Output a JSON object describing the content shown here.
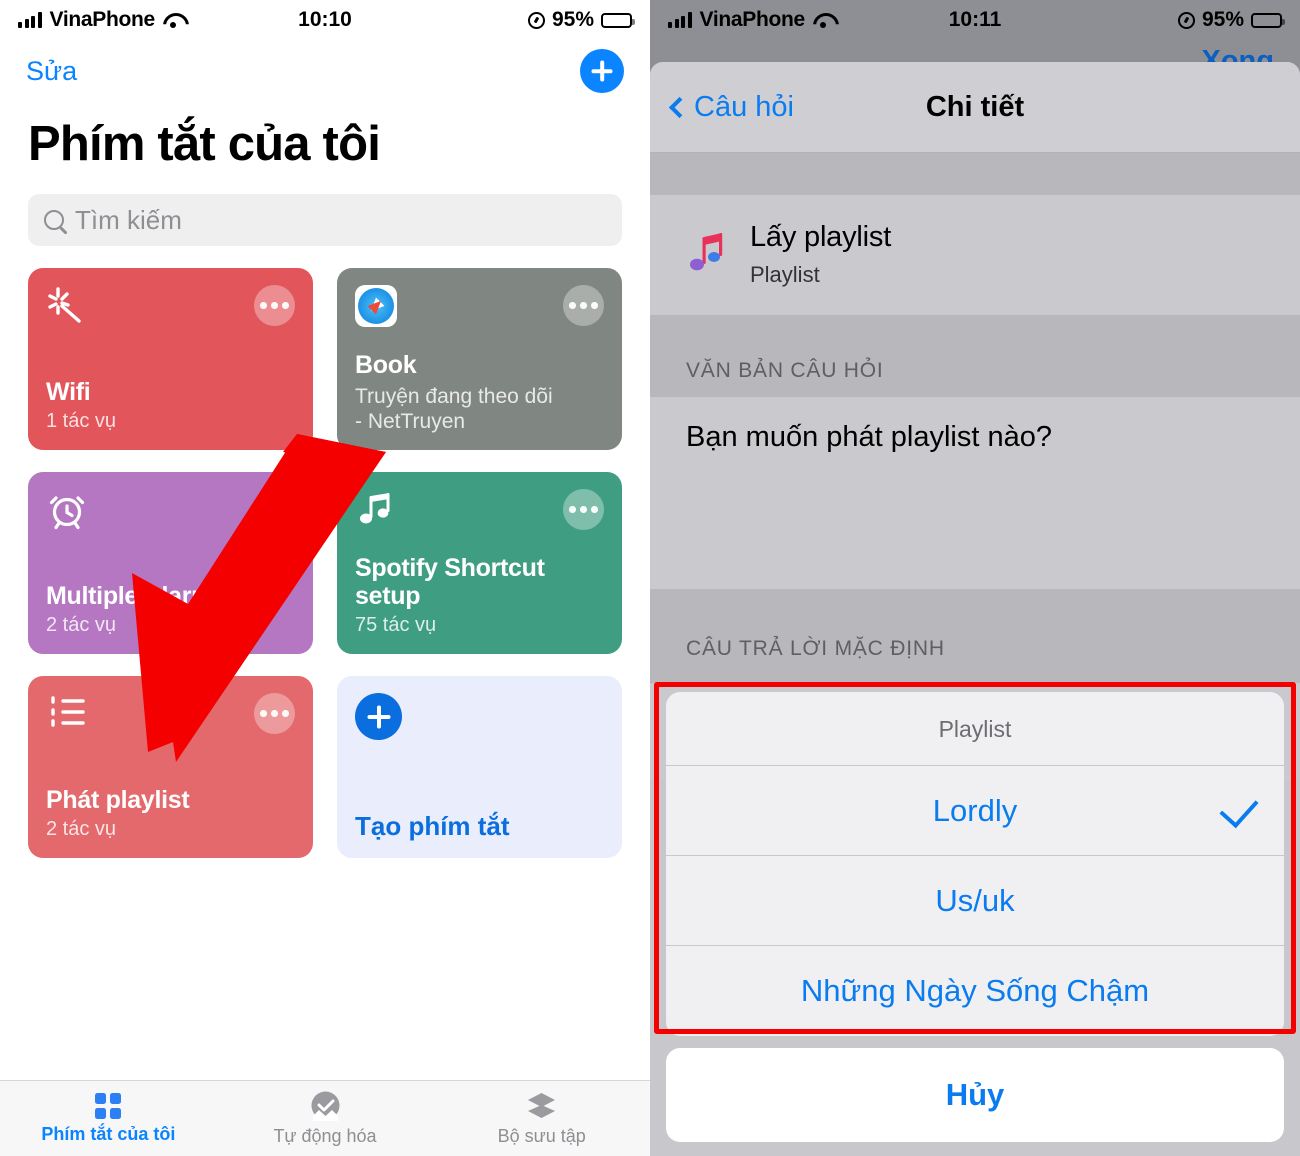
{
  "left": {
    "status": {
      "carrier": "VinaPhone",
      "time": "10:10",
      "battery": "95%",
      "icons": [
        "signal-icon",
        "wifi-icon",
        "lock-rotation-icon",
        "battery-icon"
      ]
    },
    "nav": {
      "edit_label": "Sửa",
      "add_label": "add-icon"
    },
    "title": "Phím tắt của tôi",
    "search": {
      "placeholder": "Tìm kiếm",
      "value": ""
    },
    "cards": [
      {
        "name": "Wifi",
        "sub": "1 tác vụ",
        "sub2": "",
        "icon": "magic-wand-icon",
        "color": "#e2555b"
      },
      {
        "name": "Book",
        "sub": "Truyện đang theo dõi",
        "sub2": "- NetTruyen",
        "icon": "safari-icon",
        "color": "#808782"
      },
      {
        "name": "Multiple Alarms",
        "sub": "2 tác vụ",
        "sub2": "",
        "icon": "alarm-clock-icon",
        "color": "#b577c2"
      },
      {
        "name": "Spotify Shortcut setup",
        "sub": "75 tác vụ",
        "sub2": "",
        "icon": "music-note-icon",
        "color": "#3f9e82"
      },
      {
        "name": "Phát playlist",
        "sub": "2 tác vụ",
        "sub2": "",
        "icon": "bullet-list-icon",
        "color": "#e4696d"
      },
      {
        "name": "Tạo phím tắt",
        "sub": "",
        "sub2": "",
        "icon": "plus-circle-icon",
        "color": "#eaeefc"
      }
    ],
    "tabs": [
      {
        "label": "Phím tắt của tôi",
        "icon": "grid-icon",
        "active": true
      },
      {
        "label": "Tự động hóa",
        "icon": "clock-check-icon",
        "active": false
      },
      {
        "label": "Bộ sưu tập",
        "icon": "layers-icon",
        "active": false
      }
    ]
  },
  "right": {
    "status": {
      "carrier": "VinaPhone",
      "time": "10:11",
      "battery": "95%"
    },
    "done_label": "Xong",
    "nav": {
      "back_label": "Câu hỏi",
      "title": "Chi tiết",
      "back_icon": "chevron-left-icon"
    },
    "action": {
      "title": "Lấy playlist",
      "subtitle": "Playlist",
      "icon": "music-note-icon"
    },
    "section_question": {
      "header": "VĂN BẢN CÂU HỎI",
      "text": "Bạn muốn phát playlist nào?"
    },
    "section_default": {
      "header": "CÂU TRẢ LỜI MẶC ĐỊNH",
      "key": "Playlist",
      "value": "Lordly"
    },
    "sheet": {
      "title": "Playlist",
      "options": [
        {
          "label": "Lordly",
          "selected": true
        },
        {
          "label": "Us/uk",
          "selected": false
        },
        {
          "label": "Những Ngày Sống Chậm",
          "selected": false
        }
      ],
      "cancel_label": "Hủy",
      "check_icon": "checkmark-icon"
    }
  },
  "annotation": {
    "arrow_color": "#f40000",
    "highlight_color": "#f40000"
  }
}
